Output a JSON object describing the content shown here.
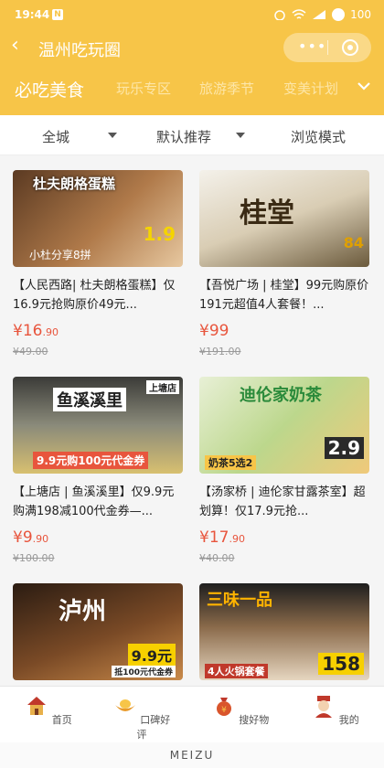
{
  "status": {
    "time": "19:44",
    "notif": "N",
    "battery": "100"
  },
  "header": {
    "title": "温州吃玩圈"
  },
  "tabs": [
    {
      "label": "必吃美食"
    },
    {
      "label": "玩乐专区"
    },
    {
      "label": "旅游季节"
    },
    {
      "label": "变美计划"
    }
  ],
  "filter": {
    "area": "全城",
    "sort": "默认推荐",
    "mode": "浏览模式"
  },
  "cards": [
    {
      "title": "【人民西路| 杜夫朗格蛋糕】仅16.9元抢购原价49元...",
      "price": "16",
      "price_dec": ".90",
      "old": "49.00",
      "img_text": "杜夫朗格蛋糕",
      "img_sub": "小杜分享8拼",
      "img_badge": "1.9"
    },
    {
      "title": "【吾悦广场 | 桂堂】99元购原价191元超值4人套餐！...",
      "price": "99",
      "price_dec": "",
      "old": "191.00",
      "img_text": "桂堂",
      "img_sub": "",
      "img_badge": "84"
    },
    {
      "title": "【上塘店 | 鱼溪溪里】仅9.9元购满198减100代金券—...",
      "price": "9",
      "price_dec": ".90",
      "old": "100.00",
      "img_text": "鱼溪溪里",
      "img_sub": "9.9元购100元代金券",
      "img_badge": "上塘店"
    },
    {
      "title": "【汤家桥 | 迪伦家甘露茶室】超划算！仅17.9元抢...",
      "price": "17",
      "price_dec": ".90",
      "old": "40.00",
      "img_text": "迪伦家奶茶",
      "img_sub": "奶茶5选2",
      "img_badge": "2.9"
    },
    {
      "title": "",
      "price": "",
      "price_dec": "",
      "old": "",
      "img_text": "泸州",
      "img_sub": "9.9元",
      "img_badge": "抵100元代金券"
    },
    {
      "title": "",
      "price": "",
      "price_dec": "",
      "old": "",
      "img_text": "三味一品",
      "img_sub": "4人火锅套餐",
      "img_badge": "158"
    }
  ],
  "bottom_nav": [
    {
      "label": "首页",
      "icon": "home-icon"
    },
    {
      "label": "口碑好评",
      "icon": "gold-ingot-icon"
    },
    {
      "label": "搜好物",
      "icon": "money-bag-icon"
    },
    {
      "label": "我的",
      "icon": "profile-icon"
    }
  ],
  "brand": "MEIZU",
  "colors": {
    "primary": "#f7c548",
    "price": "#e8553d"
  }
}
